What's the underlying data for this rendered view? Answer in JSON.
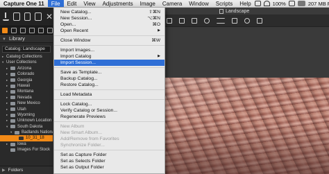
{
  "menubar": {
    "apple": "",
    "items": [
      "Capture One 11",
      "File",
      "Edit",
      "View",
      "Adjustments",
      "Image",
      "Camera",
      "Window",
      "Scripts",
      "Help"
    ],
    "active_item": "File",
    "status": {
      "battery": "100%",
      "memory": "207 MB Free"
    }
  },
  "left_panel": {
    "library_label": "Library",
    "catalog_field": "Catalog: Landscape",
    "tree": [
      {
        "label": "Catalog Collections",
        "indent": 0,
        "disc": "▸",
        "folder": false
      },
      {
        "label": "User Collections",
        "indent": 0,
        "disc": "▾",
        "folder": false
      },
      {
        "label": "Arizona",
        "indent": 1,
        "disc": "▸",
        "folder": true
      },
      {
        "label": "Colorado",
        "indent": 1,
        "disc": "▸",
        "folder": true
      },
      {
        "label": "Georgia",
        "indent": 1,
        "disc": "▸",
        "folder": true
      },
      {
        "label": "Hawaii",
        "indent": 1,
        "disc": "▸",
        "folder": true
      },
      {
        "label": "Montana",
        "indent": 1,
        "disc": "▸",
        "folder": true
      },
      {
        "label": "Nevada",
        "indent": 1,
        "disc": "▸",
        "folder": true
      },
      {
        "label": "New Mexico",
        "indent": 1,
        "disc": "▸",
        "folder": true
      },
      {
        "label": "Utah",
        "indent": 1,
        "disc": "▸",
        "folder": true
      },
      {
        "label": "Wyoming",
        "indent": 1,
        "disc": "▸",
        "folder": true
      },
      {
        "label": "Unknown Location",
        "indent": 1,
        "disc": "▸",
        "folder": true
      },
      {
        "label": "South Dakota",
        "indent": 1,
        "disc": "▾",
        "folder": true
      },
      {
        "label": "Badlands Nationa",
        "indent": 2,
        "disc": "▾",
        "folder": true
      },
      {
        "label": "10_31_18",
        "indent": 3,
        "disc": "",
        "folder": true,
        "selected": true
      },
      {
        "label": "Iowa",
        "indent": 1,
        "disc": "▸",
        "folder": true
      },
      {
        "label": "Images For Stock",
        "indent": 1,
        "disc": "",
        "folder": true
      }
    ],
    "folders_label": "Folders"
  },
  "viewer": {
    "title": "Landscape"
  },
  "file_menu": {
    "items": [
      {
        "label": "New Catalog...",
        "shortcut": "⇧⌘N",
        "enabled": true
      },
      {
        "label": "New Session...",
        "shortcut": "⌥⌘N",
        "enabled": true
      },
      {
        "label": "Open...",
        "shortcut": "⌘O",
        "enabled": true
      },
      {
        "label": "Open Recent",
        "submenu": true,
        "enabled": true
      },
      {
        "separator": true
      },
      {
        "label": "Close Window",
        "shortcut": "⌘W",
        "enabled": true
      },
      {
        "separator": true
      },
      {
        "label": "Import Images...",
        "enabled": true
      },
      {
        "label": "Import Catalog",
        "submenu": true,
        "enabled": true
      },
      {
        "label": "Import Session...",
        "enabled": true,
        "highlighted": true
      },
      {
        "separator": true
      },
      {
        "label": "Save as Template...",
        "enabled": true
      },
      {
        "label": "Backup Catalog...",
        "enabled": true
      },
      {
        "label": "Restore Catalog...",
        "enabled": true
      },
      {
        "separator": true
      },
      {
        "label": "Load Metadata",
        "enabled": true
      },
      {
        "separator": true
      },
      {
        "label": "Lock Catalog...",
        "enabled": true
      },
      {
        "label": "Verify Catalog or Session...",
        "enabled": true
      },
      {
        "label": "Regenerate Previews",
        "enabled": true
      },
      {
        "separator": true
      },
      {
        "label": "New Album",
        "enabled": false
      },
      {
        "label": "New Smart Album...",
        "enabled": false
      },
      {
        "label": "Add/Remove from Favorites",
        "enabled": false
      },
      {
        "label": "Synchronize Folder...",
        "enabled": false
      },
      {
        "separator": true
      },
      {
        "label": "Set as Capture Folder",
        "enabled": true
      },
      {
        "label": "Set as Selects Folder",
        "enabled": true
      },
      {
        "label": "Set as Output Folder",
        "enabled": true
      }
    ]
  }
}
